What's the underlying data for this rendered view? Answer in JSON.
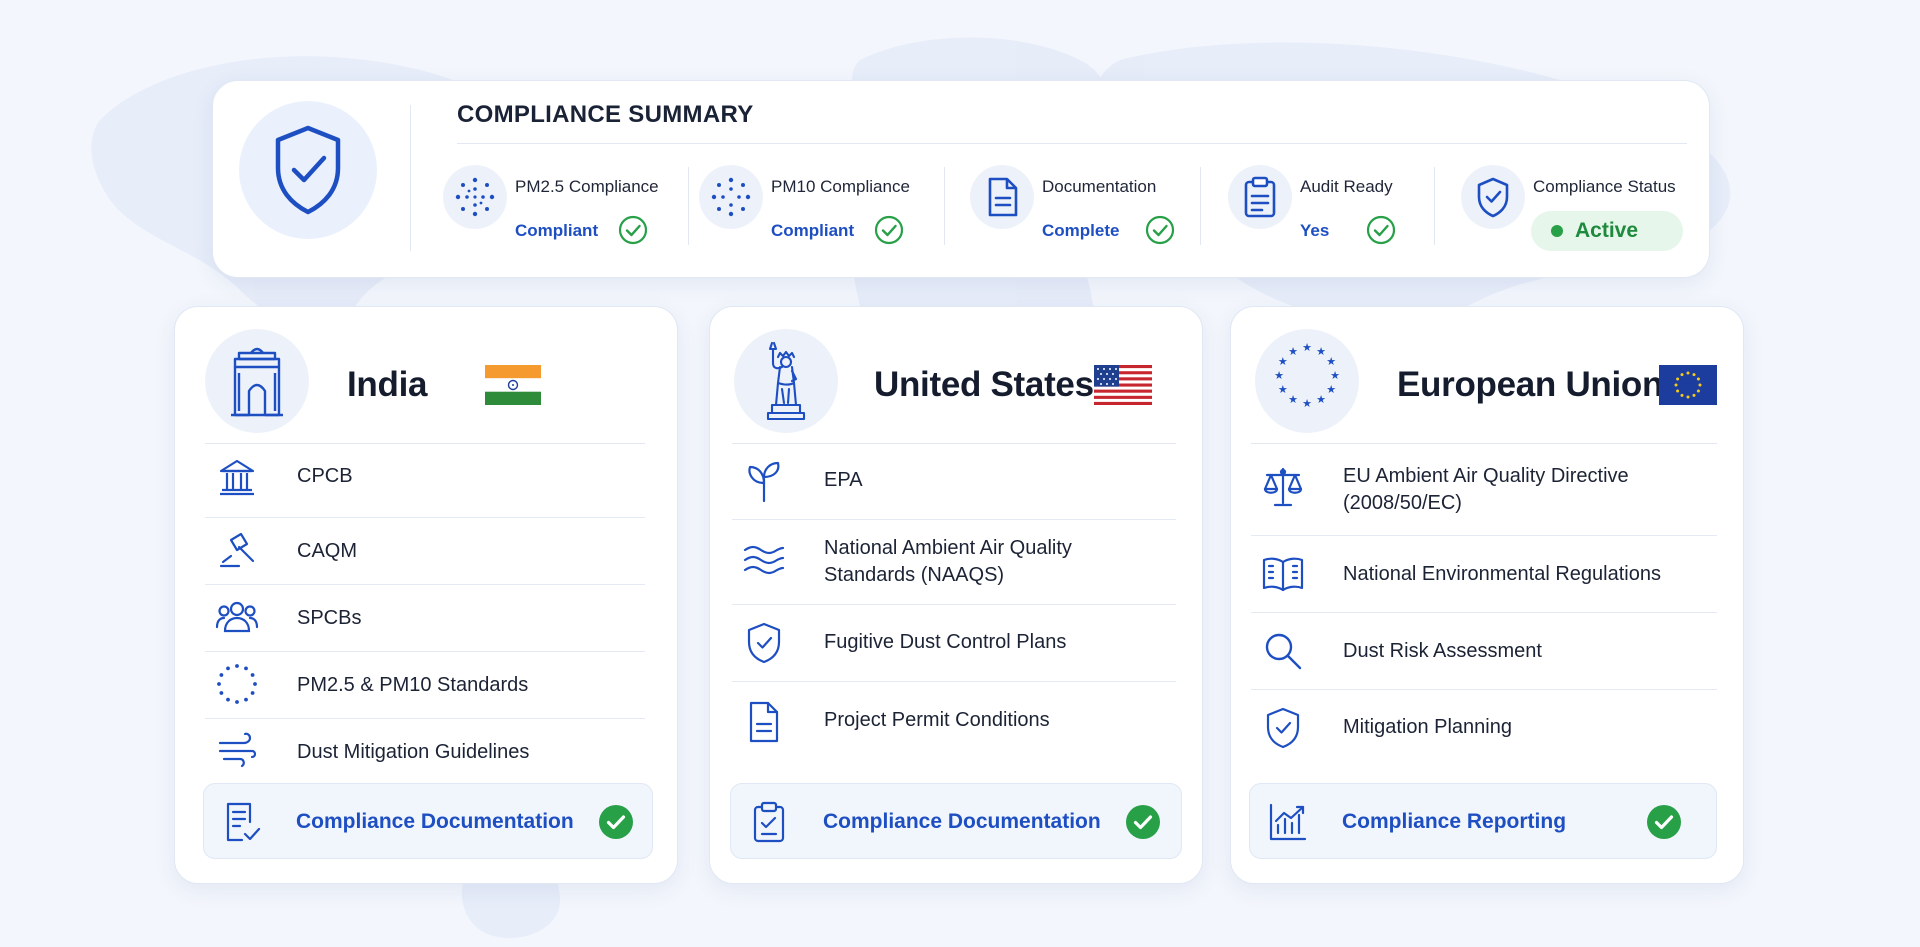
{
  "colors": {
    "accent_blue": "#1e4fc2",
    "success_green": "#27a047",
    "card_bg": "#ffffff",
    "page_bg": "#f3f6fc"
  },
  "summary": {
    "title": "COMPLIANCE SUMMARY",
    "icon": "shield-check-icon",
    "metrics": [
      {
        "label": "PM2.5 Compliance",
        "value": "Compliant",
        "icon": "particles-icon"
      },
      {
        "label": "PM10 Compliance",
        "value": "Compliant",
        "icon": "particles-icon"
      },
      {
        "label": "Documentation",
        "value": "Complete",
        "icon": "document-icon"
      },
      {
        "label": "Audit Ready",
        "value": "Yes",
        "icon": "clipboard-icon"
      }
    ],
    "status": {
      "label": "Compliance Status",
      "value": "Active",
      "icon": "shield-check-icon"
    }
  },
  "regions": [
    {
      "name": "India",
      "emblem": "india-gate-icon",
      "flag": "india-flag",
      "items": [
        {
          "label": "CPCB",
          "icon": "institution-icon"
        },
        {
          "label": "CAQM",
          "icon": "gavel-icon"
        },
        {
          "label": "SPCBs",
          "icon": "people-group-icon"
        },
        {
          "label": "PM2.5 & PM10 Standards",
          "icon": "particles-ring-icon"
        },
        {
          "label": "Dust Mitigation Guidelines",
          "icon": "wind-icon"
        }
      ],
      "footer": {
        "label": "Compliance Documentation",
        "icon": "document-check-icon"
      }
    },
    {
      "name": "United States",
      "emblem": "statue-of-liberty-icon",
      "flag": "us-flag",
      "items": [
        {
          "label": "EPA",
          "icon": "leaf-icon"
        },
        {
          "label": "National Ambient Air Quality Standards (NAAQS)",
          "icon": "air-waves-icon"
        },
        {
          "label": "Fugitive Dust Control Plans",
          "icon": "shield-check-icon"
        },
        {
          "label": "Project Permit Conditions",
          "icon": "document-icon"
        }
      ],
      "footer": {
        "label": "Compliance Documentation",
        "icon": "clipboard-icon"
      }
    },
    {
      "name": "European Union",
      "emblem": "eu-stars-icon",
      "flag": "eu-flag",
      "items": [
        {
          "label": "EU Ambient Air Quality Directive (2008/50/EC)",
          "icon": "scales-icon"
        },
        {
          "label": "National Environmental Regulations",
          "icon": "open-book-icon"
        },
        {
          "label": "Dust Risk Assessment",
          "icon": "magnifier-icon"
        },
        {
          "label": "Mitigation Planning",
          "icon": "shield-check-icon"
        }
      ],
      "footer": {
        "label": "Compliance Reporting",
        "icon": "bar-chart-icon"
      }
    }
  ]
}
